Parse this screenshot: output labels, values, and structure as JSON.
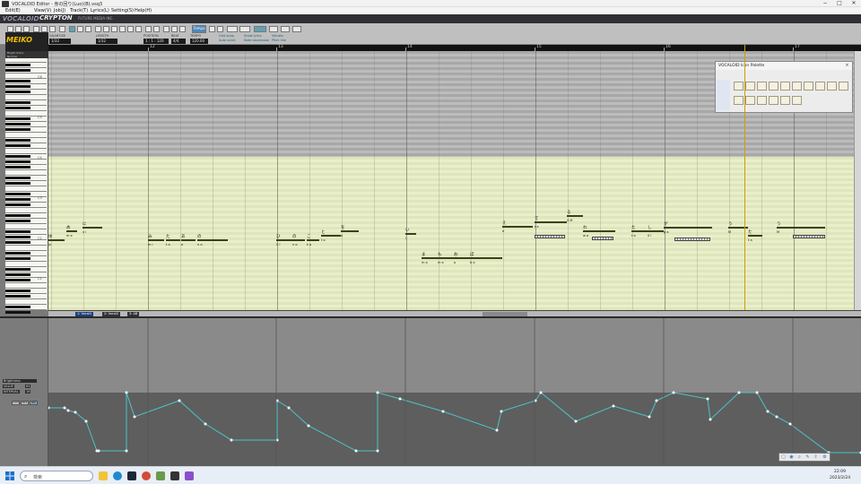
{
  "window": {
    "title": "VOCALOID Editor - 身の回り(Luo)(B).vsq3",
    "minimize": "−",
    "maximize": "□",
    "close": "✕"
  },
  "menu": [
    {
      "label": "Edit(E)"
    },
    {
      "label": "View(V)"
    },
    {
      "label": "Job(J)"
    },
    {
      "label": "Track(T)"
    },
    {
      "label": "Lyrics(L)"
    },
    {
      "label": "Setting(S)"
    },
    {
      "label": "Help(H)"
    }
  ],
  "banner": {
    "product": "VOCALOID",
    "brand": "CRYPTON",
    "subtitle": "FUTURE MEDIA INC."
  },
  "toolbar": {
    "quantize_label": "QUANTIZE",
    "quantize_value": "1/32",
    "length_label": "LENGTH",
    "length_value": "1/32",
    "position_label": "POSITION",
    "position_value": "1 : 1 : 120",
    "beat_label": "BEAT",
    "beat_value": "4/4",
    "tempo_label": "TEMPO",
    "tempo_value": "120.00",
    "tempo_button": "Tempo",
    "check1": "Grid snap",
    "check2": "Auto scroll",
    "check3": "Show lyrics",
    "check4": "Note expression",
    "check5": "Vibrato",
    "check6": "Pitch line"
  },
  "singer": {
    "name": "MEIKO",
    "info1": "Bright Voice",
    "info2": "Normal"
  },
  "ruler": {
    "bars": [
      "12",
      "13",
      "14",
      "15",
      "16",
      "17"
    ]
  },
  "piano": {
    "octaves": [
      "C6",
      "C5",
      "C4",
      "C3",
      "C2",
      "C1"
    ]
  },
  "notes": [
    {
      "lyric": "ゆ",
      "sub": "ju"
    },
    {
      "lyric": "め",
      "sub": "m e"
    },
    {
      "lyric": "に",
      "sub": "n i"
    },
    {
      "lyric": "み",
      "sub": "m i"
    },
    {
      "lyric": "た",
      "sub": "t a"
    },
    {
      "lyric": "あ",
      "sub": "a"
    },
    {
      "lyric": "の",
      "sub": "n o"
    },
    {
      "lyric": "ひ",
      "sub": "C i"
    },
    {
      "lyric": "の",
      "sub": "n o"
    },
    {
      "lyric": "こ",
      "sub": "k o"
    },
    {
      "lyric": "と",
      "sub": "t o"
    },
    {
      "lyric": "を",
      "sub": "o"
    },
    {
      "lyric": "い",
      "sub": "i"
    },
    {
      "lyric": "ま",
      "sub": "m a"
    },
    {
      "lyric": "も",
      "sub": "m o"
    },
    {
      "lyric": "お",
      "sub": "o"
    },
    {
      "lyric": "ぼ",
      "sub": "b o"
    },
    {
      "lyric": "え",
      "sub": "e"
    },
    {
      "lyric": "て",
      "sub": "t e"
    },
    {
      "lyric": "る",
      "sub": "4 M"
    },
    {
      "lyric": "わ",
      "sub": "w a"
    },
    {
      "lyric": "た",
      "sub": "t a"
    },
    {
      "lyric": "し",
      "sub": "S i"
    },
    {
      "lyric": "が",
      "sub": "g a"
    },
    {
      "lyric": "う",
      "sub": "M"
    },
    {
      "lyric": "た",
      "sub": "t a"
    },
    {
      "lyric": "う",
      "sub": "M"
    }
  ],
  "tracks": {
    "track1": "1: Vocal1",
    "track2": "2: Vocal2",
    "track3": "3: AB"
  },
  "control": {
    "param_label": "Brightness",
    "value_label": "VALUE",
    "value": "64",
    "interval_label": "INTERVAL",
    "interval_value": "16",
    "btn1": "DYN",
    "btn2": "BRE",
    "btn3": "BRI"
  },
  "palette": {
    "title": "VOCALOID Icon Palette",
    "close": "×"
  },
  "taskbar": {
    "search_placeholder": "検索",
    "time": "22:09",
    "date": "2023/2/24"
  }
}
